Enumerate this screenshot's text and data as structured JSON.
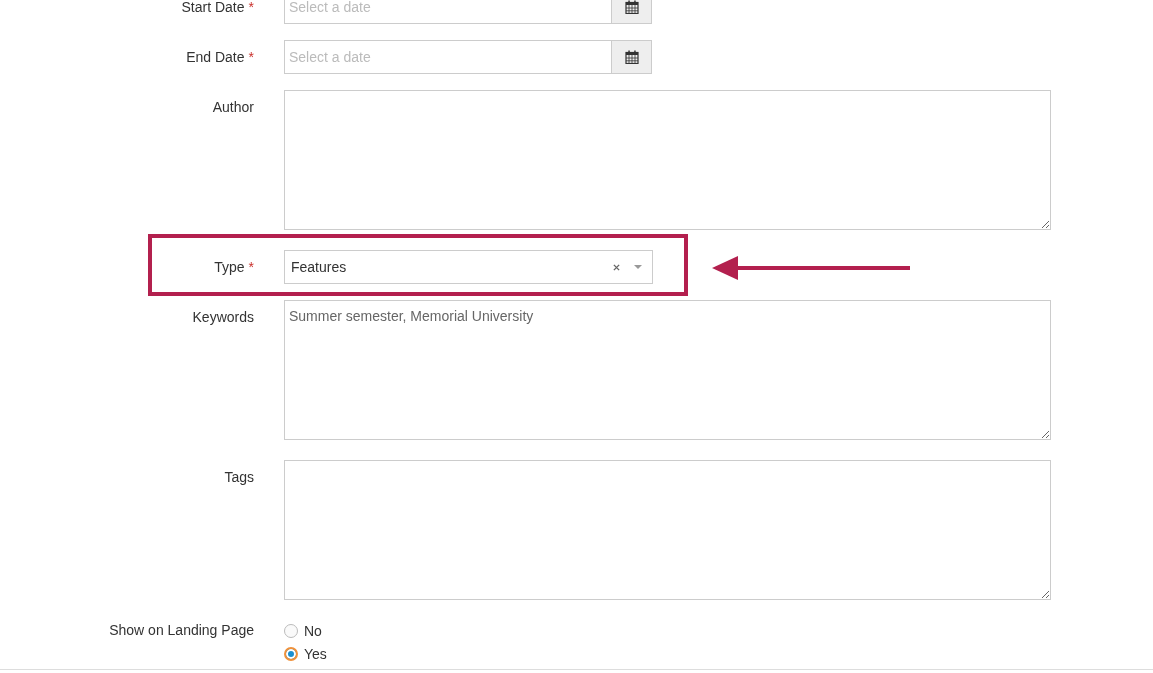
{
  "fields": [
    {
      "kind": "date",
      "label": "Start Date",
      "required_mark": "*",
      "placeholder": "Select a date"
    },
    {
      "kind": "date",
      "label": "End Date",
      "required_mark": "*",
      "placeholder": "Select a date"
    },
    {
      "kind": "textarea",
      "label": "Author"
    },
    {
      "kind": "select",
      "label": "Type",
      "required_mark": "*",
      "value": "Features",
      "highlighted": true
    },
    {
      "kind": "textarea",
      "label": "Keywords",
      "value": "Summer semester, Memorial University"
    },
    {
      "kind": "textarea",
      "label": "Tags"
    },
    {
      "kind": "radio",
      "label": "Show on Landing Page",
      "options": [
        {
          "label": "No",
          "selected": false
        },
        {
          "label": "Yes",
          "selected": true
        }
      ]
    }
  ]
}
